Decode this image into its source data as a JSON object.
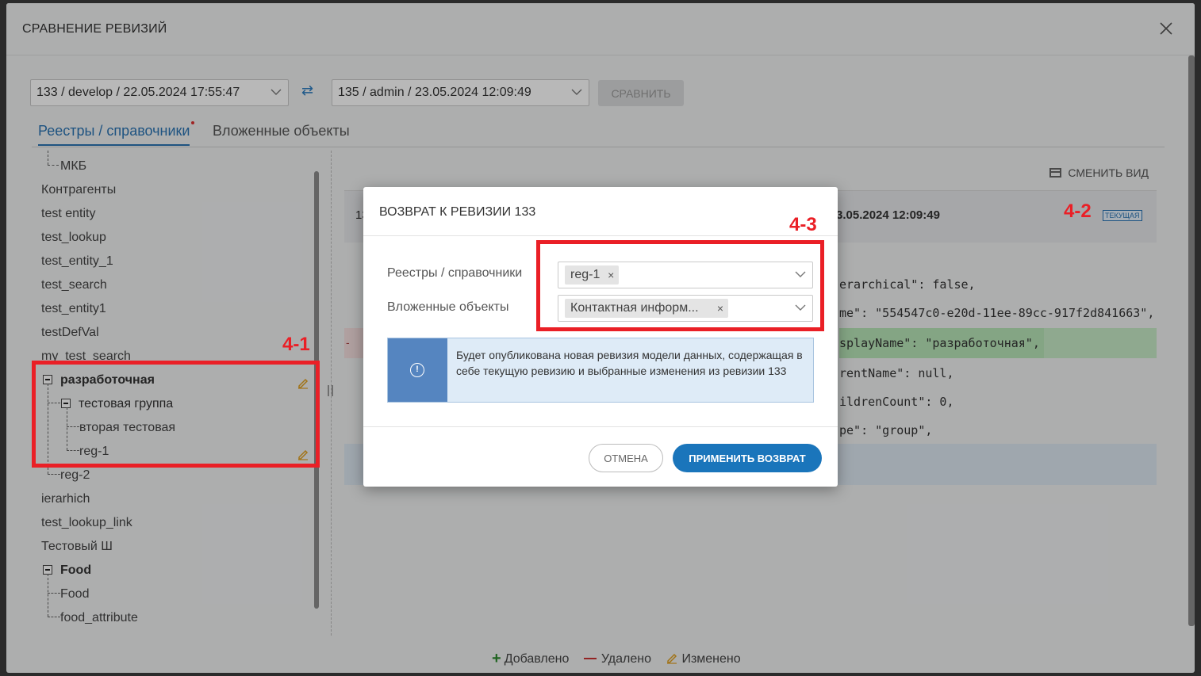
{
  "window": {
    "title": "СРАВНЕНИЕ РЕВИЗИЙ",
    "left_revision": "133 / develop / 22.05.2024 17:55:47",
    "right_revision": "135 / admin / 23.05.2024 12:09:49",
    "compare_label": "СРАВНИТЬ",
    "swap_icon": "⇄"
  },
  "tabs": [
    {
      "label": "Реестры / справочники",
      "active": true,
      "has_dot": true
    },
    {
      "label": "Вложенные объекты",
      "active": false
    }
  ],
  "tree": [
    {
      "label": "МКБ"
    },
    {
      "label": "Контрагенты"
    },
    {
      "label": "test entity"
    },
    {
      "label": "test_lookup"
    },
    {
      "label": "test_entity_1"
    },
    {
      "label": "test_search"
    },
    {
      "label": "test_entity1"
    },
    {
      "label": "testDefVal"
    },
    {
      "label": "my_test_search"
    },
    {
      "label": "разработочная"
    },
    {
      "label": "тестовая группа"
    },
    {
      "label": "вторая тестовая"
    },
    {
      "label": "reg-1"
    },
    {
      "label": "reg-2"
    },
    {
      "label": "ierarhich"
    },
    {
      "label": "test_lookup_link"
    },
    {
      "label": "Тестовый Ш"
    },
    {
      "label": "Food"
    },
    {
      "label": "Food"
    },
    {
      "label": "food_attribute"
    }
  ],
  "right_panel": {
    "change_view_label": "СМЕНИТЬ ВИД",
    "header_left_partial": "13",
    "header_right": "3.05.2024 12:09:49",
    "current_badge": "ТЕКУЩАЯ",
    "code_lines": [
      "erarchical\": false,",
      "me\": \"554547c0-e20d-11ee-89cc-917f2d841663\",",
      "splayName\": \"разработочная\",",
      "rentName\": null,",
      "ildrenCount\": 0,",
      "pe\": \"group\","
    ],
    "diff_minus": "-"
  },
  "legend": {
    "added": "Добавлено",
    "removed": "Удалено",
    "changed": "Изменено"
  },
  "modal": {
    "title": "ВОЗВРАТ К РЕВИЗИИ 133",
    "registry_label": "Реестры / справочники",
    "registry_chip": "reg-1",
    "nested_label": "Вложенные объекты",
    "nested_chip": "Контактная информ...",
    "chip_remove": "×",
    "info_icon": "!",
    "info_text": "Будет опубликована новая ревизия модели данных, содержащая в себе текущую ревизию и выбранные изменения из ревизии 133",
    "cancel_label": "ОТМЕНА",
    "apply_label": "ПРИМЕНИТЬ ВОЗВРАТ"
  },
  "annotations": {
    "a1": "4-1",
    "a2": "4-2",
    "a3": "4-3"
  },
  "colors": {
    "accent": "#1a75bb",
    "annotation": "#ea1f26",
    "added": "#2e8b2e",
    "removed": "#c33333",
    "changed": "#e0a020"
  }
}
